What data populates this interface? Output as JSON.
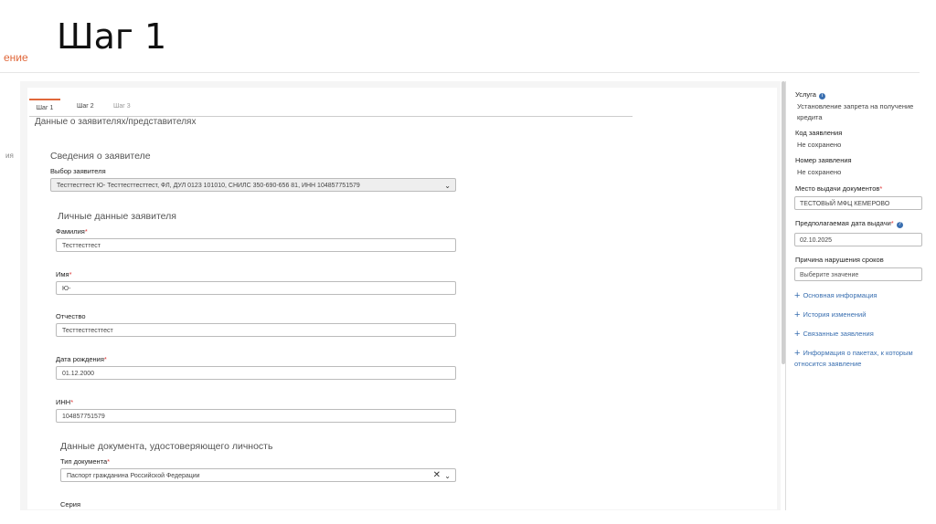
{
  "slide": {
    "title": "Шаг 1",
    "ghost_top": "ение",
    "ghost_side": "ия"
  },
  "tabs": [
    {
      "label": "Шаг 1"
    },
    {
      "label": "Шаг 2"
    },
    {
      "label": "Шаг 3"
    }
  ],
  "form": {
    "heading": "Данные о заявителях/представителях",
    "applicant_section": "Сведения о заявителе",
    "applicant_select_label": "Выбор заявителя",
    "applicant_select_value": "Тесттесттест Ю- Тесттесттесттест, ФЛ, ДУЛ 0123 101010, СНИЛС 350-690-656 81, ИНН 104857751579",
    "personal_section": "Личные данные заявителя",
    "surname_label": "Фамилия",
    "surname_value": "Тесттесттест",
    "name_label": "Имя",
    "name_value": "Ю-",
    "patronymic_label": "Отчество",
    "patronymic_value": "Тесттесттесттест",
    "birth_label": "Дата рождения",
    "birth_value": "01.12.2000",
    "inn_label": "ИНН",
    "inn_value": "104857751579",
    "doc_section": "Данные документа, удостоверяющего личность",
    "doc_type_label": "Тип документа",
    "doc_type_value": "Паспорт гражданина Российской Федерации",
    "series_label": "Серия",
    "required_mark": "*"
  },
  "side": {
    "service_label": "Услуга",
    "service_value": "Установление запрета на получение кредита",
    "code_label": "Код заявления",
    "code_value": "Не сохранено",
    "number_label": "Номер заявления",
    "number_value": "Не сохранено",
    "place_label": "Место выдачи документов",
    "place_value": "ТЕСТОВЫЙ МФЦ КЕМЕРОВО",
    "date_label": "Предполагаемая дата выдачи",
    "date_value": "02.10.2025",
    "reason_label": "Причина нарушения сроков",
    "reason_placeholder": "Выберите значение",
    "links": [
      "Основная информация",
      "История изменений",
      "Связанные заявления",
      "Информация о пакетах, к которым относится заявление"
    ]
  },
  "colors": {
    "accent": "#e0673a",
    "link": "#3a6fb0",
    "required": "#dd3333"
  }
}
